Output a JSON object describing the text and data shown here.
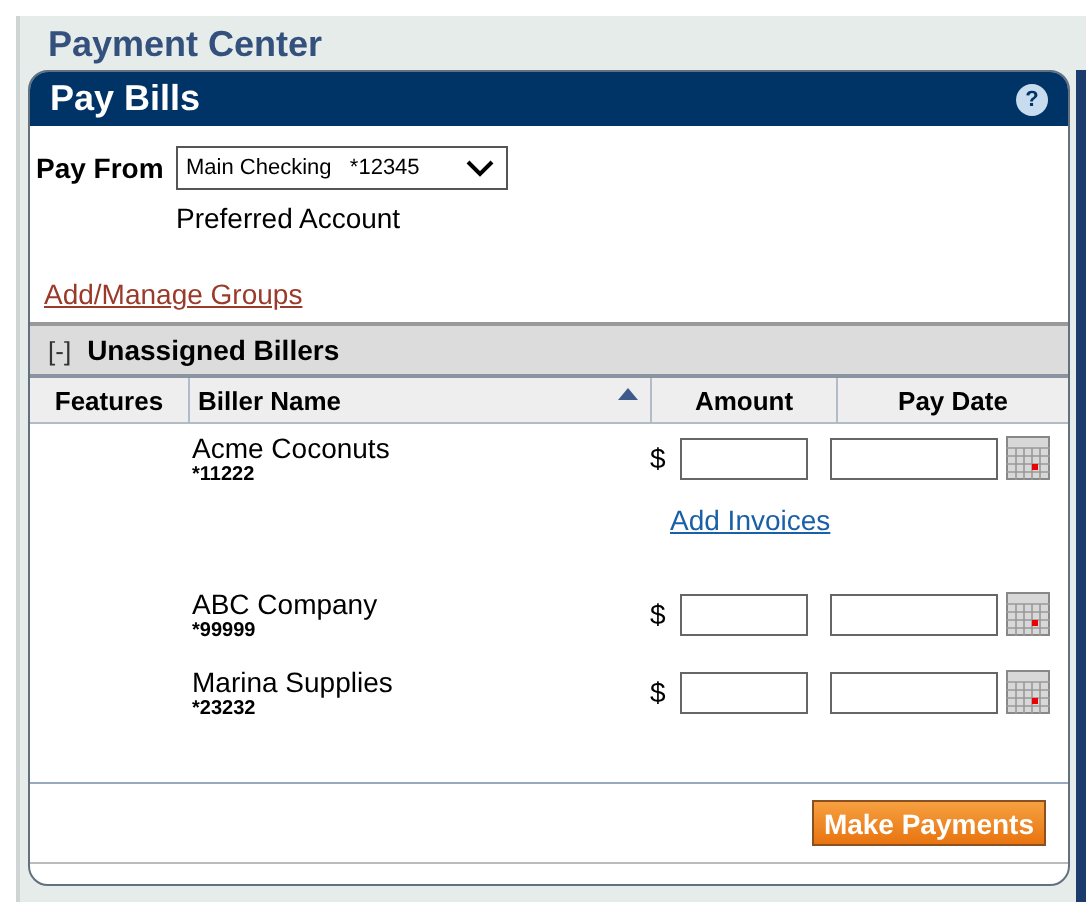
{
  "page_title": "Payment Center",
  "panel": {
    "title": "Pay Bills",
    "help": "?"
  },
  "pay_from": {
    "label": "Pay From",
    "value": "Main Checking   *12345",
    "note": "Preferred Account"
  },
  "groups_link": "Add/Manage Groups",
  "group": {
    "toggle": "[-]",
    "title": "Unassigned Billers",
    "expanded": true
  },
  "columns": [
    {
      "label": "Features",
      "sorted": false
    },
    {
      "label": "Biller Name",
      "sorted": true
    },
    {
      "label": "Amount",
      "sorted": false
    },
    {
      "label": "Pay Date",
      "sorted": false
    }
  ],
  "billers": [
    {
      "name": "Acme Coconuts",
      "account": "*11222",
      "currency": "$",
      "link": "Add Invoices"
    },
    {
      "name": "ABC Company",
      "account": "*99999",
      "currency": "$"
    },
    {
      "name": "Marina Supplies",
      "account": "*23232",
      "currency": "$"
    }
  ],
  "submit": "Make Payments"
}
